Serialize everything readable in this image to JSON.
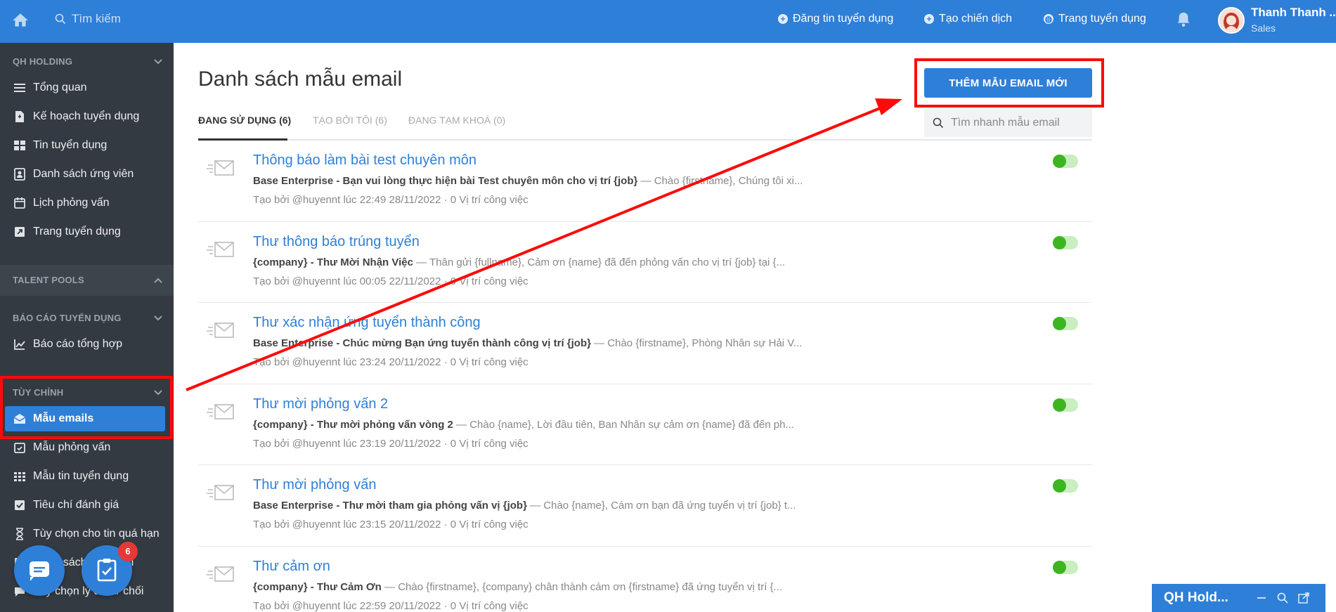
{
  "topbar": {
    "search_placeholder": "Tìm kiếm",
    "nav": [
      {
        "label": "Đăng tin tuyển dụng",
        "icon": "plus-circle-icon"
      },
      {
        "label": "Tạo chiến dịch",
        "icon": "plus-circle-icon"
      },
      {
        "label": "Trang tuyển dụng",
        "icon": "globe-icon"
      }
    ],
    "user": {
      "name": "Thanh Thanh ...",
      "role": "Sales"
    }
  },
  "sidebar": {
    "sections": [
      {
        "title": "QH HOLDING",
        "items": [
          "Tổng quan",
          "Kế hoạch tuyển dụng",
          "Tin tuyển dụng",
          "Danh sách ứng viên",
          "Lịch phỏng vấn",
          "Trang tuyển dụng"
        ]
      },
      {
        "title": "TALENT POOLS",
        "items": []
      },
      {
        "title": "BÁO CÁO TUYỂN DỤNG",
        "items": [
          "Báo cáo tổng hợp"
        ]
      },
      {
        "title": "TÙY CHỈNH",
        "items": [
          "Mẫu emails",
          "Mẫu phỏng vấn",
          "Mẫu tin tuyển dụng",
          "Tiêu chí đánh giá",
          "Tùy chọn cho tin quá hạn",
          "Danh sách ứng viên",
          "Tùy chọn lý do từ chối"
        ]
      }
    ],
    "active_item": "Mẫu emails"
  },
  "main": {
    "title": "Danh sách mẫu email",
    "add_button": "THÊM MẪU EMAIL MỚI",
    "tabs": [
      "ĐANG SỬ DỤNG (6)",
      "TẠO BỞI TÔI (6)",
      "ĐANG TẠM KHOÁ (0)"
    ],
    "active_tab": 0,
    "quick_search_placeholder": "Tìm nhanh mẫu email",
    "templates": [
      {
        "title": "Thông báo làm bài test chuyên môn",
        "subject": "Base Enterprise - Bạn vui lòng thực hiện bài Test chuyên môn cho vị trí {job}",
        "preview": " — Chào {firstname}, Chúng tôi xi...",
        "meta": "Tạo bởi @huyennt lúc 22:49 28/11/2022 · 0 Vị trí công việc",
        "enabled": true
      },
      {
        "title": "Thư thông báo trúng tuyển",
        "subject": "{company} - Thư Mời Nhận Việc",
        "preview": " — Thân gửi {fullname}, Cảm ơn {name} đã đến phỏng vấn cho vị trí {job} tại {...",
        "meta": "Tạo bởi @huyennt lúc 00:05 22/11/2022 · 0 Vị trí công việc",
        "enabled": true
      },
      {
        "title": "Thư xác nhận ứng tuyển thành công",
        "subject": "Base Enterprise - Chúc mừng Bạn ứng tuyển thành công vị trí {job}",
        "preview": " — Chào {firstname}, Phòng Nhân sự Hải V...",
        "meta": "Tạo bởi @huyennt lúc 23:24 20/11/2022 · 0 Vị trí công việc",
        "enabled": true
      },
      {
        "title": "Thư mời phỏng vấn 2",
        "subject": "{company} - Thư mời phỏng vấn vòng 2",
        "preview": " — Chào {name}, Lời đầu tiên, Ban Nhân sự cảm ơn {name} đã đến ph...",
        "meta": "Tạo bởi @huyennt lúc 23:19 20/11/2022 · 0 Vị trí công việc",
        "enabled": true
      },
      {
        "title": "Thư mời phỏng vấn",
        "subject": "Base Enterprise - Thư mời tham gia phỏng vấn vị {job}",
        "preview": " — Chào {name}, Cám ơn bạn đã ứng tuyển vị trí {job} t...",
        "meta": "Tạo bởi @huyennt lúc 23:15 20/11/2022 · 0 Vị trí công việc",
        "enabled": true
      },
      {
        "title": "Thư cảm ơn",
        "subject": "{company} - Thư Cảm Ơn",
        "preview": " — Chào {firstname}, {company} chân thành cám ơn {firstname} đã ứng tuyển vị trí {...",
        "meta": "Tạo bởi @huyennt lúc 22:59 20/11/2022 · 0 Vị trí công việc",
        "enabled": true
      }
    ]
  },
  "widgets": {
    "task_badge": "6",
    "mini_panel_title": "QH Hold..."
  },
  "colors": {
    "primary": "#2e7fd8",
    "sidebar": "#333a41",
    "toggle_on": "#3cb521",
    "annotation": "#ff0a0a"
  }
}
